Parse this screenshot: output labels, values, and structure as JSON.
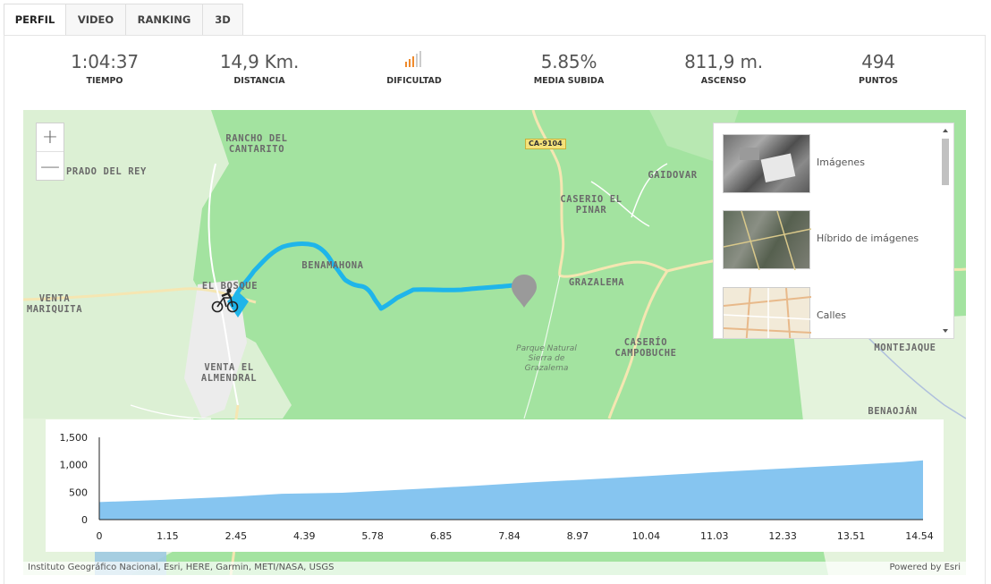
{
  "tabs": [
    {
      "label": "PERFIL",
      "active": true
    },
    {
      "label": "VIDEO",
      "active": false
    },
    {
      "label": "RANKING",
      "active": false
    },
    {
      "label": "3D",
      "active": false
    }
  ],
  "stats": {
    "tiempo": {
      "value": "1:04:37",
      "label": "TIEMPO"
    },
    "distancia": {
      "value": "14,9 Km.",
      "label": "DISTANCIA"
    },
    "dificultad": {
      "icon": "difficulty-bars-icon",
      "label": "DIFICULTAD"
    },
    "media": {
      "value": "5.85%",
      "label": "MEDIA SUBIDA"
    },
    "ascenso": {
      "value": "811,9 m.",
      "label": "ASCENSO"
    },
    "puntos": {
      "value": "494",
      "label": "PUNTOS"
    }
  },
  "colors": {
    "route": "#1fb5ea",
    "difficulty_active": "#ef8a2c",
    "difficulty_inactive": "#cccccc",
    "area_fill": "#86c5f0"
  },
  "map": {
    "zoom_in": "+",
    "zoom_out": "—",
    "road_sign": "CA-9104",
    "places": [
      {
        "id": "rancho",
        "text": "RANCHO DEL CANTARITO"
      },
      {
        "id": "prado",
        "text": "PRADO DEL REY"
      },
      {
        "id": "gaidovar",
        "text": "GAIDOVAR"
      },
      {
        "id": "caserio-pinar",
        "text": "CASERIO EL PINAR"
      },
      {
        "id": "benamahona",
        "text": "BENAMAHONA"
      },
      {
        "id": "el-bosque",
        "text": "EL BOSQUE"
      },
      {
        "id": "grazalema",
        "text": "GRAZALEMA"
      },
      {
        "id": "venta-mariquita",
        "text": "VENTA MARIQUITA"
      },
      {
        "id": "caserio-campobuche",
        "text": "CASERÍO CAMPOBUCHE"
      },
      {
        "id": "venta-almendral",
        "text": "VENTA EL ALMENDRAL"
      },
      {
        "id": "montejaque",
        "text": "MONTEJAQUE"
      },
      {
        "id": "benaojan",
        "text": "BENAOJÁN"
      }
    ],
    "park": "Parque Natural Sierra de Grazalema",
    "basemaps": [
      {
        "label": "Imágenes",
        "icon": "satellite-thumb"
      },
      {
        "label": "Híbrido de imágenes",
        "icon": "hybrid-thumb"
      },
      {
        "label": "Calles",
        "icon": "streets-thumb"
      }
    ],
    "attribution": "Instituto Geográfico Nacional, Esri, HERE, Garmin, METI/NASA, USGS",
    "powered": "Powered by Esri"
  },
  "chart_data": {
    "type": "area",
    "title": "",
    "xlabel": "",
    "ylabel": "",
    "x_tick_labels": [
      "0",
      "1.15",
      "2.45",
      "4.39",
      "5.78",
      "6.85",
      "7.84",
      "8.97",
      "10.04",
      "11.03",
      "12.33",
      "13.51",
      "14.54"
    ],
    "y_tick_labels": [
      "0",
      "500",
      "1,000",
      "1,500"
    ],
    "ylim": [
      0,
      1500
    ],
    "xlim": [
      0,
      14.9
    ],
    "grid": false,
    "series": [
      {
        "x": [
          0,
          1.15,
          2.45,
          3.3,
          4.39,
          5.78,
          6.85,
          7.84,
          8.97,
          10.04,
          11.03,
          12.33,
          13.51,
          14.54,
          14.9
        ],
        "values": [
          320,
          360,
          420,
          470,
          490,
          560,
          620,
          680,
          740,
          800,
          860,
          930,
          990,
          1050,
          1080
        ]
      }
    ]
  }
}
